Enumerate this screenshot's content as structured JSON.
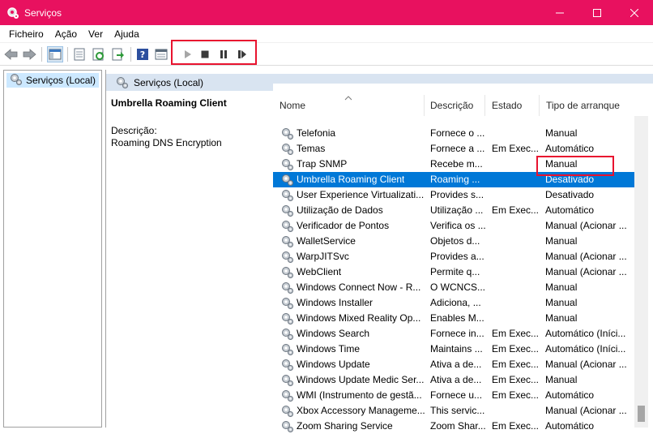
{
  "window": {
    "title": "Serviços"
  },
  "menu": [
    "Ficheiro",
    "Ação",
    "Ver",
    "Ajuda"
  ],
  "tree": {
    "selected_label": "Serviços (Local)"
  },
  "panel": {
    "header": "Serviços (Local)",
    "service_title": "Umbrella Roaming Client",
    "description_label": "Descrição:",
    "description_text": "Roaming DNS Encryption"
  },
  "columns": {
    "name": "Nome",
    "description": "Descrição",
    "state": "Estado",
    "startup": "Tipo de arranque"
  },
  "rows": [
    {
      "name": "Telefonia",
      "description": "Fornece o ...",
      "state": "",
      "startup": "Manual"
    },
    {
      "name": "Temas",
      "description": "Fornece a ...",
      "state": "Em Exec...",
      "startup": "Automático"
    },
    {
      "name": "Trap SNMP",
      "description": "Recebe m...",
      "state": "",
      "startup": "Manual"
    },
    {
      "name": "Umbrella Roaming Client",
      "description": "Roaming ...",
      "state": "",
      "startup": "Desativado"
    },
    {
      "name": "User Experience Virtualizati...",
      "description": "Provides s...",
      "state": "",
      "startup": "Desativado"
    },
    {
      "name": "Utilização de Dados",
      "description": "Utilização ...",
      "state": "Em Exec...",
      "startup": "Automático"
    },
    {
      "name": "Verificador de Pontos",
      "description": "Verifica os ...",
      "state": "",
      "startup": "Manual (Acionar ..."
    },
    {
      "name": "WalletService",
      "description": "Objetos d...",
      "state": "",
      "startup": "Manual"
    },
    {
      "name": "WarpJITSvc",
      "description": "Provides a...",
      "state": "",
      "startup": "Manual (Acionar ..."
    },
    {
      "name": "WebClient",
      "description": "Permite q...",
      "state": "",
      "startup": "Manual (Acionar ..."
    },
    {
      "name": "Windows Connect Now - R...",
      "description": "O WCNCS...",
      "state": "",
      "startup": "Manual"
    },
    {
      "name": "Windows Installer",
      "description": "Adiciona, ...",
      "state": "",
      "startup": "Manual"
    },
    {
      "name": "Windows Mixed Reality Op...",
      "description": "Enables M...",
      "state": "",
      "startup": "Manual"
    },
    {
      "name": "Windows Search",
      "description": "Fornece in...",
      "state": "Em Exec...",
      "startup": "Automático (Iníci..."
    },
    {
      "name": "Windows Time",
      "description": "Maintains ...",
      "state": "Em Exec...",
      "startup": "Automático (Iníci..."
    },
    {
      "name": "Windows Update",
      "description": "Ativa a de...",
      "state": "Em Exec...",
      "startup": "Manual (Acionar ..."
    },
    {
      "name": "Windows Update Medic Ser...",
      "description": "Ativa a de...",
      "state": "Em Exec...",
      "startup": "Manual"
    },
    {
      "name": "WMI (Instrumento de gestã...",
      "description": "Fornece u...",
      "state": "Em Exec...",
      "startup": "Automático"
    },
    {
      "name": "Xbox Accessory Manageme...",
      "description": "This servic...",
      "state": "",
      "startup": "Manual (Acionar ..."
    },
    {
      "name": "Zoom Sharing Service",
      "description": "Zoom Shar...",
      "state": "Em Exec...",
      "startup": "Automático"
    }
  ],
  "selected_row_index": 3,
  "colors": {
    "titlebar": "#e8115f",
    "selection": "#0078d7",
    "highlight_box": "#e8132f",
    "header_band": "#d9e4f1"
  },
  "toolbar_icons": [
    "back-icon",
    "forward-icon",
    "show-hide-console-tree-icon",
    "export-list-icon",
    "refresh-icon",
    "export-icon",
    "help-icon",
    "properties-icon",
    "start-service-icon",
    "stop-service-icon",
    "pause-service-icon",
    "restart-service-icon"
  ]
}
